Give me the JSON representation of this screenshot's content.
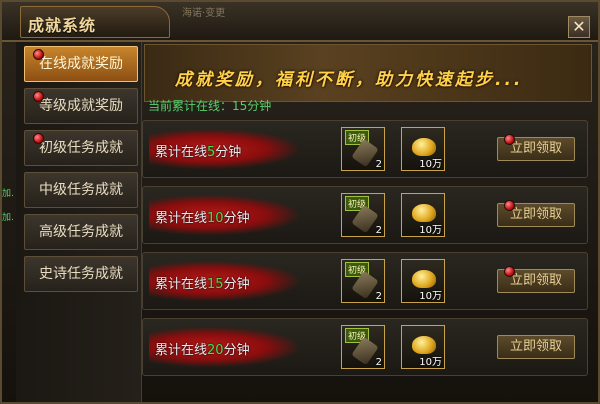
{
  "window": {
    "title": "成就系统",
    "header_deco": "海诺·变更"
  },
  "close_label": "✕",
  "sidebar": {
    "items": [
      {
        "label": "在线成就奖励",
        "active": true,
        "alert": true
      },
      {
        "label": "等级成就奖励",
        "active": false,
        "alert": true
      },
      {
        "label": "初级任务成就",
        "active": false,
        "alert": true
      },
      {
        "label": "中级任务成就",
        "active": false,
        "alert": false
      },
      {
        "label": "高级任务成就",
        "active": false,
        "alert": false
      },
      {
        "label": "史诗任务成就",
        "active": false,
        "alert": false
      }
    ]
  },
  "banner": {
    "slogan": "成就奖励，福利不断，助力快速起步..."
  },
  "status": {
    "current_online": "当前累计在线：15分钟"
  },
  "rewards": [
    {
      "label_prefix": "累计在线",
      "minutes": "5",
      "label_suffix": "分钟",
      "item1_badge": "初级",
      "item1_count": "2",
      "item2_count": "10万",
      "button": "立即领取"
    },
    {
      "label_prefix": "累计在线",
      "minutes": "10",
      "label_suffix": "分钟",
      "item1_badge": "初级",
      "item1_count": "2",
      "item2_count": "10万",
      "button": "立即领取"
    },
    {
      "label_prefix": "累计在线",
      "minutes": "15",
      "label_suffix": "分钟",
      "item1_badge": "初级",
      "item1_count": "2",
      "item2_count": "10万",
      "button": "立即领取"
    },
    {
      "label_prefix": "累计在线",
      "minutes": "20",
      "label_suffix": "分钟",
      "item1_badge": "初级",
      "item1_count": "2",
      "item2_count": "10万",
      "button": "立即领取"
    }
  ],
  "edge_text": [
    "加.",
    "加."
  ],
  "colors": {
    "accent_orange": "#c7852d",
    "online_green": "#57d06a",
    "banner_gold": "#ffd24a",
    "alert_red": "#c01010"
  }
}
